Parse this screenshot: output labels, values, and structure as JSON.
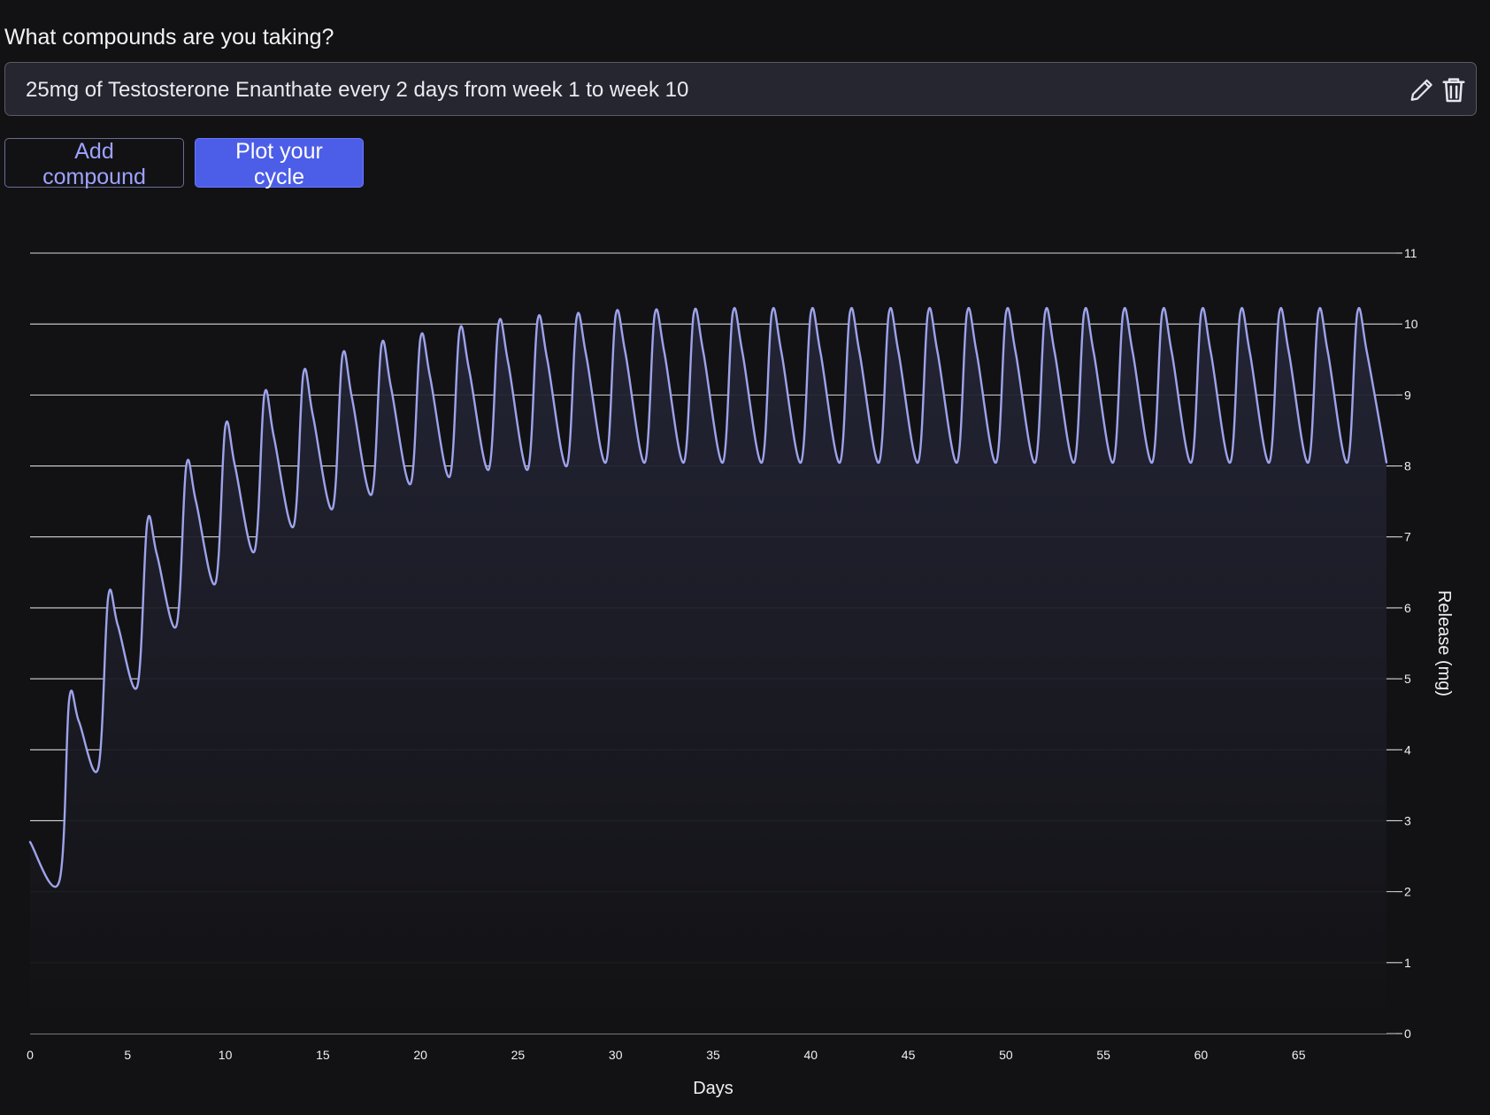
{
  "question": "What compounds are you taking?",
  "compounds": [
    {
      "text": "25mg of Testosterone Enanthate every 2 days from week 1 to week 10"
    }
  ],
  "actions": {
    "add_compound": "Add compound",
    "plot_cycle": "Plot your cycle"
  },
  "icons": {
    "edit": "pencil-icon",
    "delete": "trash-icon"
  },
  "colors": {
    "background": "#121214",
    "line": "#9ea3eb",
    "fill_top": "#232434",
    "primary_button": "#4c5ee8"
  },
  "chart_data": {
    "type": "area",
    "xlabel": "Days",
    "ylabel": "Release (mg)",
    "xlim": [
      0,
      70
    ],
    "ylim": [
      0,
      11
    ],
    "xticks": [
      0,
      5,
      10,
      15,
      20,
      25,
      30,
      35,
      40,
      45,
      50,
      55,
      60,
      65
    ],
    "yticks": [
      0,
      1,
      2,
      3,
      4,
      5,
      6,
      7,
      8,
      9,
      10,
      11
    ],
    "grid": true,
    "series": [
      {
        "x": [
          0,
          1.5,
          2.0,
          2.5,
          3.5,
          4.0,
          4.5,
          5.5,
          6.0,
          6.5,
          7.5,
          8.0,
          8.5,
          9.5,
          10.0,
          10.5,
          11.5,
          12.0,
          12.5,
          13.5,
          14.0,
          14.5,
          15.5,
          16.0,
          16.5,
          17.5,
          18.0,
          18.5,
          19.5,
          20.0,
          20.5,
          21.5,
          22.0,
          22.5,
          23.5,
          24.0,
          24.5,
          25.5,
          26.0,
          26.5,
          27.5,
          28.0,
          28.5,
          29.5,
          30.0,
          30.5,
          31.5,
          32.0,
          32.5,
          33.5,
          34.0,
          34.5,
          35.5,
          36.0,
          36.5,
          37.5,
          38.0,
          38.5,
          39.5,
          40.0,
          40.5,
          41.5,
          42.0,
          42.5,
          43.5,
          44.0,
          44.5,
          45.5,
          46.0,
          46.5,
          47.5,
          48.0,
          48.5,
          49.5,
          50.0,
          50.5,
          51.5,
          52.0,
          52.5,
          53.5,
          54.0,
          54.5,
          55.5,
          56.0,
          56.5,
          57.5,
          58.0,
          58.5,
          59.5,
          60.0,
          60.5,
          61.5,
          62.0,
          62.5,
          63.5,
          64.0,
          64.5,
          65.5,
          66.0,
          66.5,
          67.5,
          68.0,
          68.5,
          69.5
        ],
        "values": [
          2.7,
          2.15,
          4.7,
          4.4,
          3.75,
          6.15,
          5.75,
          4.9,
          7.2,
          6.75,
          5.75,
          8.0,
          7.5,
          6.35,
          8.55,
          8.0,
          6.8,
          9.0,
          8.4,
          7.15,
          9.3,
          8.7,
          7.4,
          9.55,
          8.95,
          7.6,
          9.7,
          9.1,
          7.75,
          9.8,
          9.25,
          7.85,
          9.9,
          9.35,
          7.95,
          10.0,
          9.45,
          7.95,
          10.05,
          9.5,
          8.0,
          10.08,
          9.55,
          8.05,
          10.12,
          9.6,
          8.05,
          10.13,
          9.6,
          8.05,
          10.14,
          9.6,
          8.05,
          10.15,
          9.6,
          8.05,
          10.15,
          9.6,
          8.05,
          10.15,
          9.6,
          8.05,
          10.15,
          9.6,
          8.05,
          10.15,
          9.6,
          8.05,
          10.15,
          9.6,
          8.05,
          10.15,
          9.6,
          8.05,
          10.15,
          9.6,
          8.05,
          10.15,
          9.6,
          8.05,
          10.15,
          9.6,
          8.05,
          10.15,
          9.6,
          8.05,
          10.15,
          9.6,
          8.05,
          10.15,
          9.6,
          8.05,
          10.15,
          9.6,
          8.05,
          10.15,
          9.6,
          8.05,
          10.15,
          9.6,
          8.05,
          10.15,
          9.6,
          8.05
        ]
      }
    ]
  }
}
